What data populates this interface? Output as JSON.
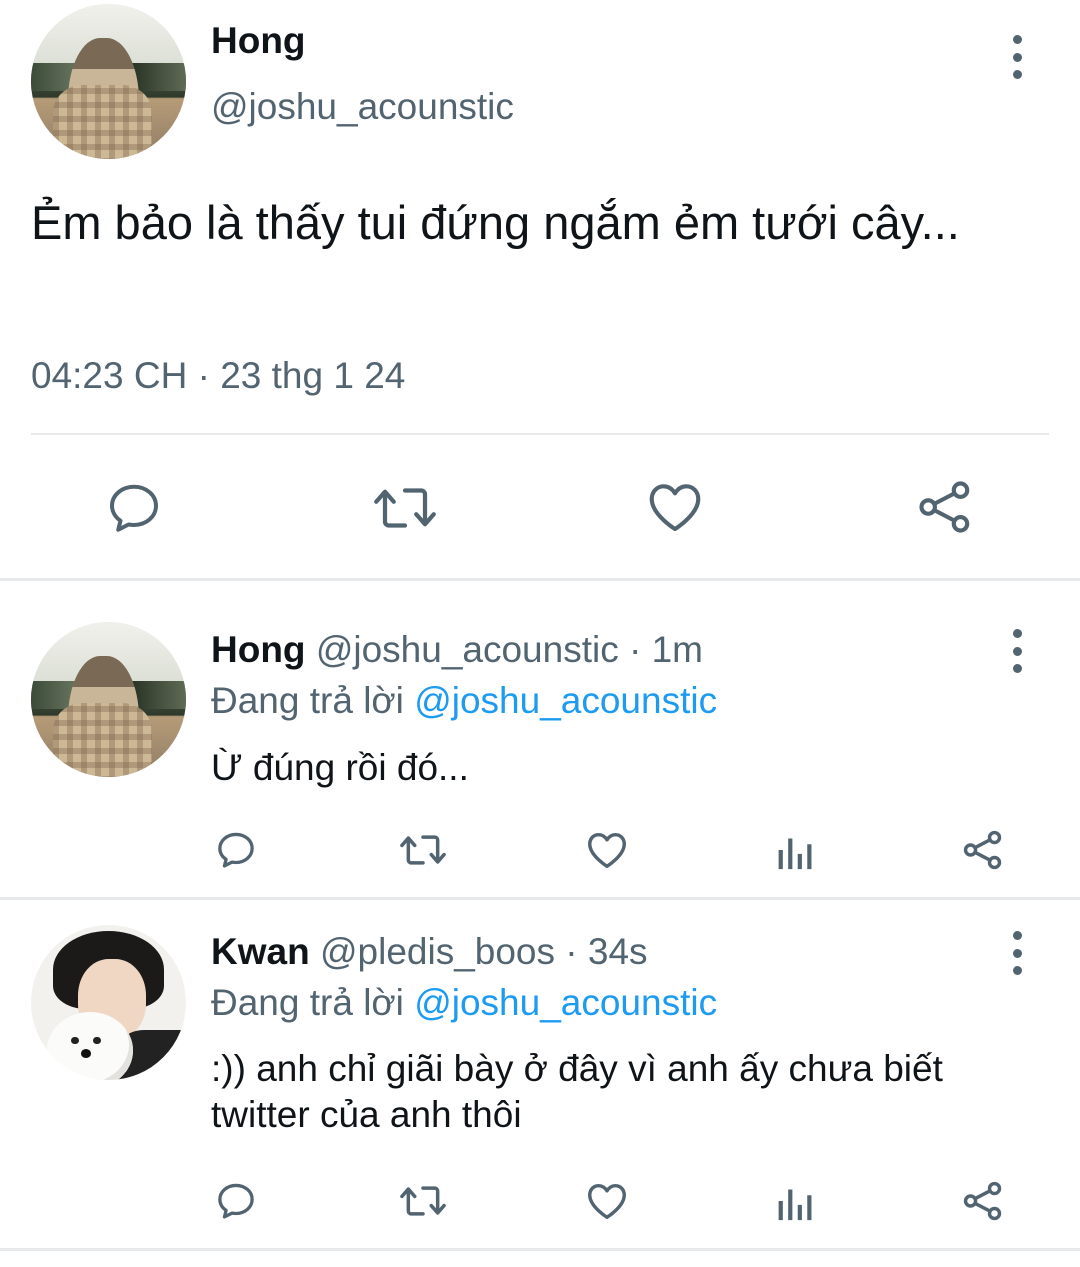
{
  "main_tweet": {
    "name": "Hong",
    "handle": "@joshu_acounstic",
    "text": "Ẻm bảo là thấy tui đứng ngắm ẻm tưới cây...",
    "timestamp": "04:23 CH · 23 thg 1 24",
    "actions": [
      "reply-icon",
      "retweet-icon",
      "like-icon",
      "share-icon"
    ]
  },
  "replies": [
    {
      "name": "Hong",
      "handle": "@joshu_acounstic",
      "time": " · 1m",
      "replying_label": "Đang trả lời ",
      "replying_to": "@joshu_acounstic",
      "text": "Ừ đúng rồi đó...",
      "actions": [
        "reply-icon",
        "retweet-icon",
        "like-icon",
        "analytics-icon",
        "share-icon"
      ]
    },
    {
      "name": "Kwan",
      "handle": "@pledis_boos",
      "time": " · 34s",
      "replying_label": "Đang trả lời ",
      "replying_to": "@joshu_acounstic",
      "text": ":)) anh chỉ giãi bày ở đây vì anh ấy chưa biết twitter của anh thôi",
      "actions": [
        "reply-icon",
        "retweet-icon",
        "like-icon",
        "analytics-icon",
        "share-icon"
      ]
    }
  ],
  "colors": {
    "text": "#0f1419",
    "secondary": "#536471",
    "link": "#1d9bf0",
    "divider": "#e7e9ea"
  }
}
